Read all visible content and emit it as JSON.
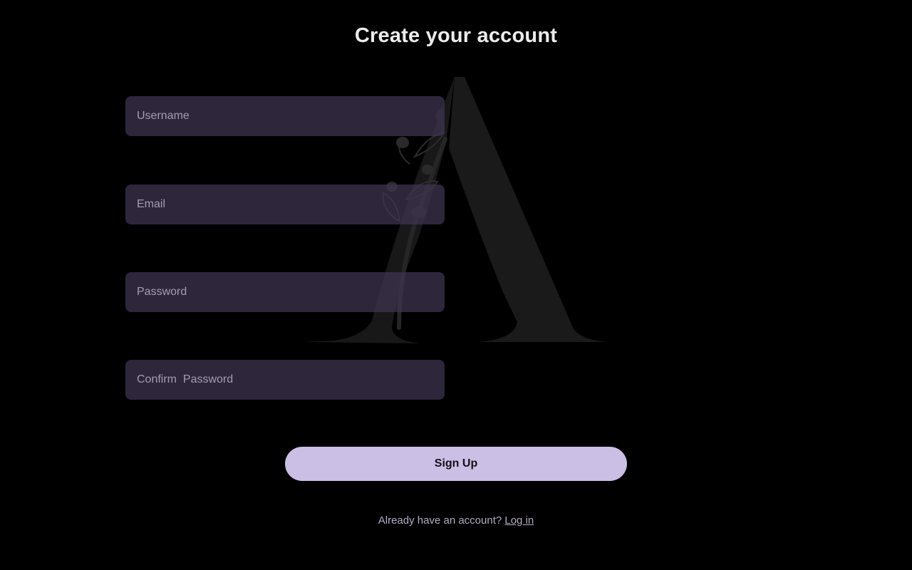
{
  "page": {
    "title": "Create your account"
  },
  "form": {
    "username": {
      "placeholder": "Username",
      "value": ""
    },
    "email": {
      "placeholder": "Email",
      "value": ""
    },
    "password": {
      "placeholder": "Password",
      "value": ""
    },
    "confirm_password": {
      "placeholder": "Confirm  Password",
      "value": ""
    }
  },
  "actions": {
    "signup_label": "Sign Up"
  },
  "footer": {
    "prompt": "Already have an account?",
    "login_label": "Log in"
  },
  "theme": {
    "background": "#000000",
    "field_background": "#302838",
    "button_background": "#cbbfe6",
    "watermark_color": "#1c1c1c"
  },
  "decorations": {
    "watermark_icon": "letter-a-with-branch-icon"
  }
}
